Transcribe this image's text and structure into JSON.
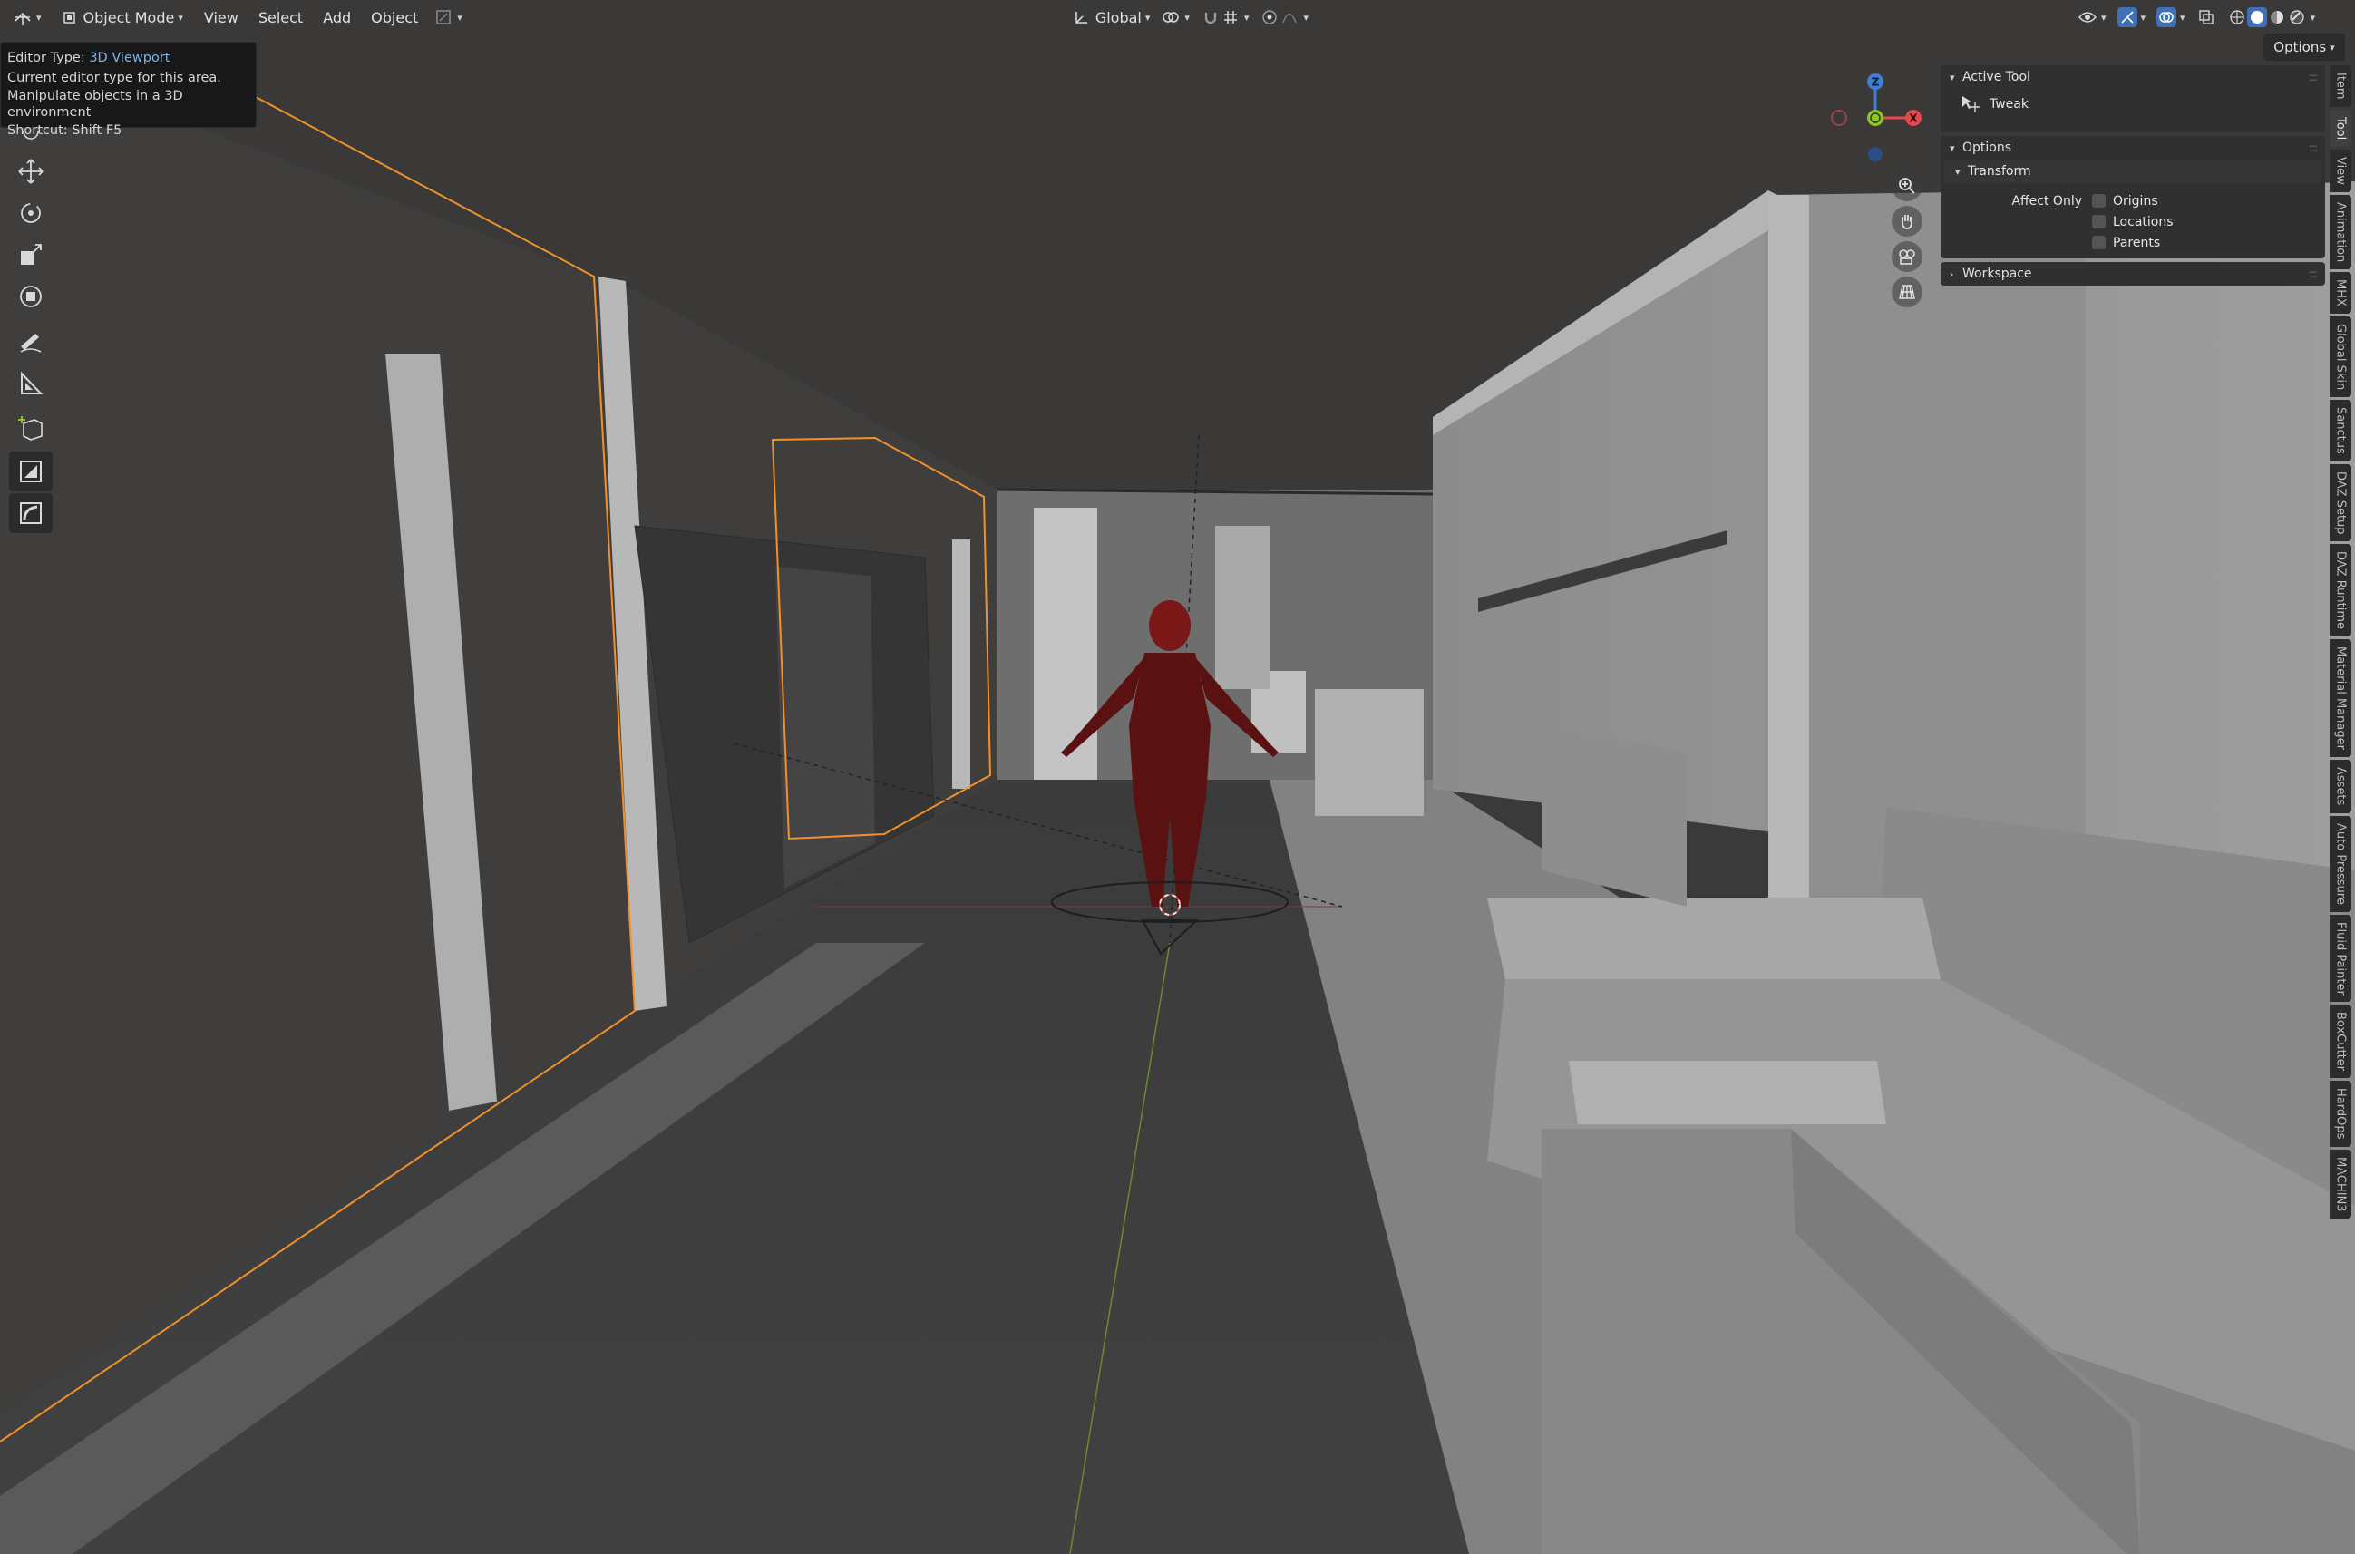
{
  "header": {
    "editor_type_icon": "editor-type-icon",
    "mode": "Object Mode",
    "menus": [
      "View",
      "Select",
      "Add",
      "Object"
    ],
    "orientation": "Global",
    "options_label": "Options"
  },
  "tooltip": {
    "title_prefix": "Editor Type:",
    "title_value": "3D Viewport",
    "line1": "Current editor type for this area.",
    "line2": "Manipulate objects in a 3D environment",
    "shortcut": "Shortcut: Shift F5"
  },
  "toolbar": {
    "tools": [
      "cursor-icon",
      "move-icon",
      "rotate-icon",
      "scale-icon",
      "transform-icon",
      "annotate-icon",
      "measure-icon",
      "add-cube-icon",
      "box-cutter-icon",
      "hard-ops-icon"
    ]
  },
  "gizmo": {
    "z": "Z",
    "x": "X"
  },
  "panel": {
    "active_tool": {
      "header": "Active Tool",
      "tool_name": "Tweak"
    },
    "options": {
      "header": "Options",
      "transform_header": "Transform",
      "affect_only_label": "Affect Only",
      "checkboxes": [
        {
          "label": "Origins",
          "checked": false
        },
        {
          "label": "Locations",
          "checked": false
        },
        {
          "label": "Parents",
          "checked": false
        }
      ]
    },
    "workspace": {
      "header": "Workspace"
    }
  },
  "tabs": [
    "Item",
    "Tool",
    "View",
    "Animation",
    "MHX",
    "Global Skin",
    "Sanctus",
    "DAZ Setup",
    "DAZ Runtime",
    "Material Manager",
    "Assets",
    "Auto Pressure",
    "Fluid Painter",
    "BoxCutter",
    "HardOps",
    "MACHIN3"
  ],
  "active_tab": "Tool",
  "colors": {
    "selection_outline": "#f0912a",
    "axis_x": "#e8474e",
    "axis_y": "#8ec32a",
    "axis_z": "#3d7fd6",
    "character": "#6e1414"
  }
}
